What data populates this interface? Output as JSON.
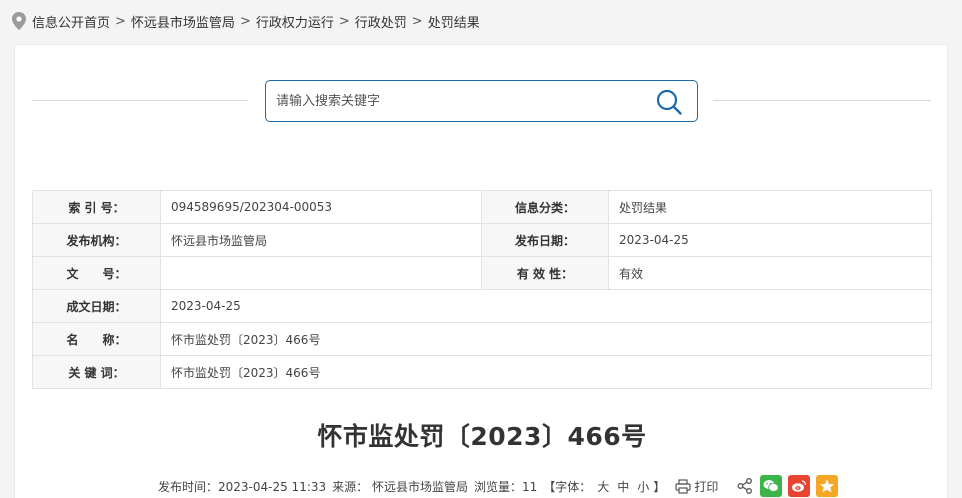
{
  "breadcrumb": {
    "items": [
      "信息公开首页",
      "怀远县市场监管局",
      "行政权力运行",
      "行政处罚",
      "处罚结果"
    ],
    "separators": [
      ">",
      ">",
      ">",
      ">"
    ]
  },
  "search": {
    "placeholder": "请输入搜索关键字"
  },
  "meta": {
    "index_label": "索 引 号：",
    "index_value": "094589695/202304-00053",
    "category_label": "信息分类：",
    "category_value": "处罚结果",
    "org_label": "发布机构：",
    "org_value": "怀远县市场监管局",
    "pub_date_label": "发布日期：",
    "pub_date_value": "2023-04-25",
    "doc_no_label": "文　　号：",
    "doc_no_value": "",
    "validity_label": "有 效 性：",
    "validity_value": "有效",
    "created_label": "成文日期：",
    "created_value": "2023-04-25",
    "name_label": "名　　称：",
    "name_value": "怀市监处罚〔2023〕466号",
    "keywords_label": "关 键 词：",
    "keywords_value": "怀市监处罚〔2023〕466号"
  },
  "doc_title": "怀市监处罚〔2023〕466号",
  "info_bar": {
    "publish_time": "发布时间：2023-04-25 11:33",
    "source": "来源： 怀远县市场监管局",
    "views": "浏览量：11",
    "font_label": "【字体：",
    "font_large": "大",
    "font_medium": "中",
    "font_small": "小",
    "font_end": "】",
    "print_label": "打印"
  },
  "icons": {
    "location": "location-pin-icon",
    "search": "search-icon",
    "print": "printer-icon",
    "share": "share-icon",
    "wechat": "wechat-icon",
    "weibo": "weibo-icon",
    "qzone": "qzone-star-icon"
  },
  "colors": {
    "accent": "#1e6aa7",
    "wechat": "#3bb449",
    "weibo": "#e8442f",
    "qzone": "#f5a623"
  }
}
